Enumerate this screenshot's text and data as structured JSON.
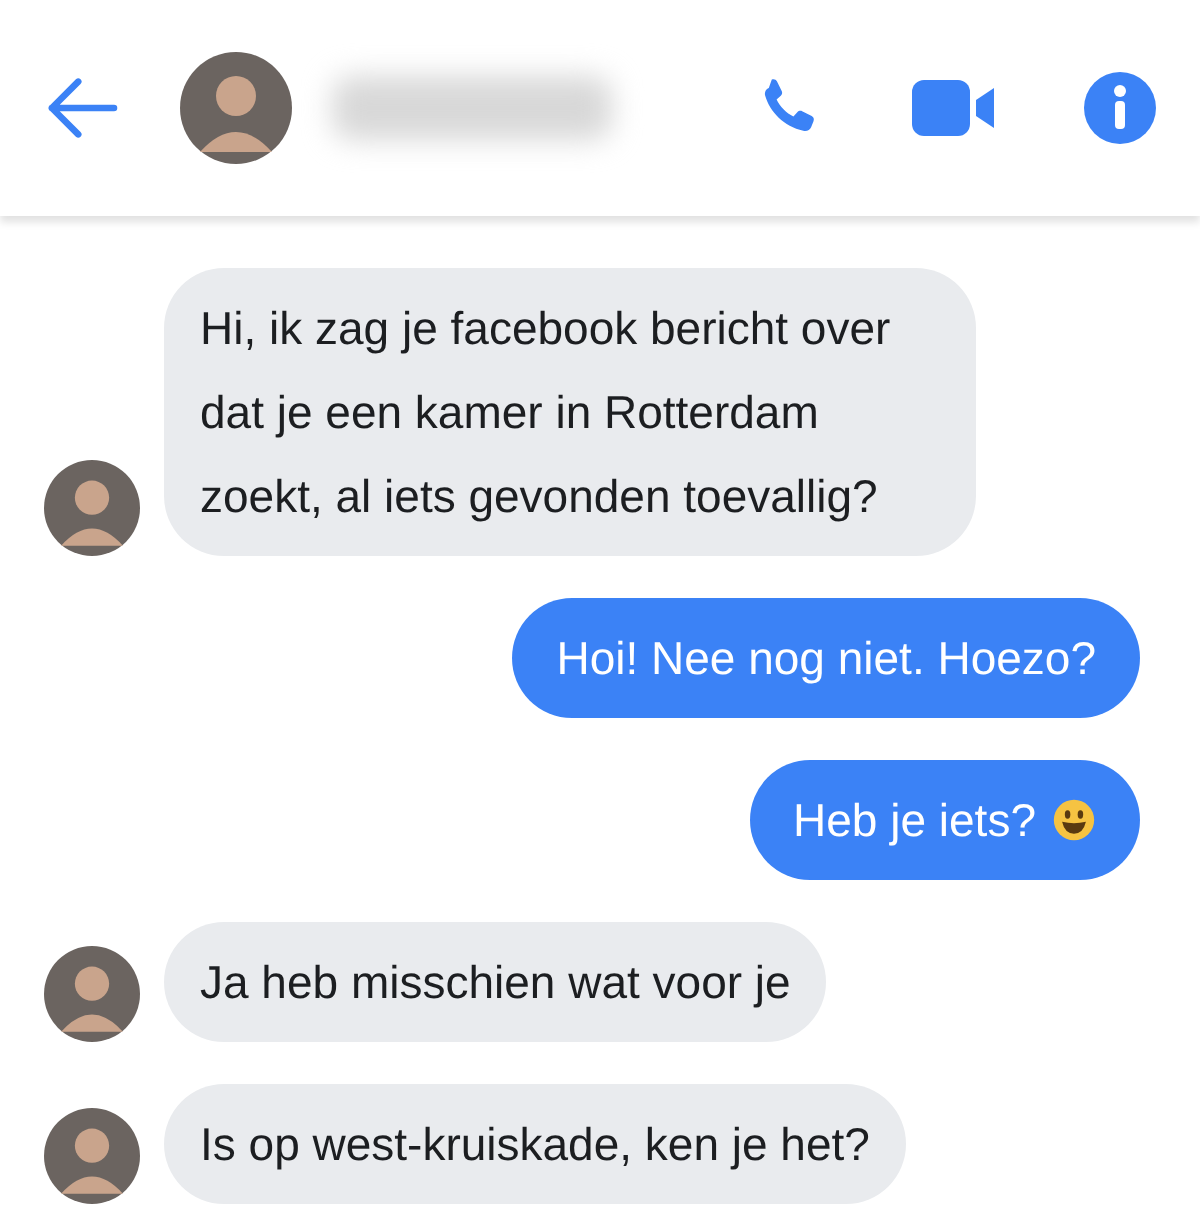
{
  "messages": [
    {
      "kind": "incoming",
      "text": "Hi, ik zag je facebook bericht over dat je een kamer in Rotterdam zoekt, al iets gevonden toevallig?",
      "avatar": true
    },
    {
      "kind": "outgoing",
      "text": "Hoi! Nee nog niet. Hoezo?"
    },
    {
      "kind": "outgoing",
      "text": "Heb je iets?",
      "emoji": true
    },
    {
      "kind": "incoming",
      "text": "Ja heb misschien wat voor je",
      "avatar": true
    },
    {
      "kind": "incoming",
      "text": "Is op west-kruiskade, ken je het?",
      "avatar": true
    }
  ]
}
